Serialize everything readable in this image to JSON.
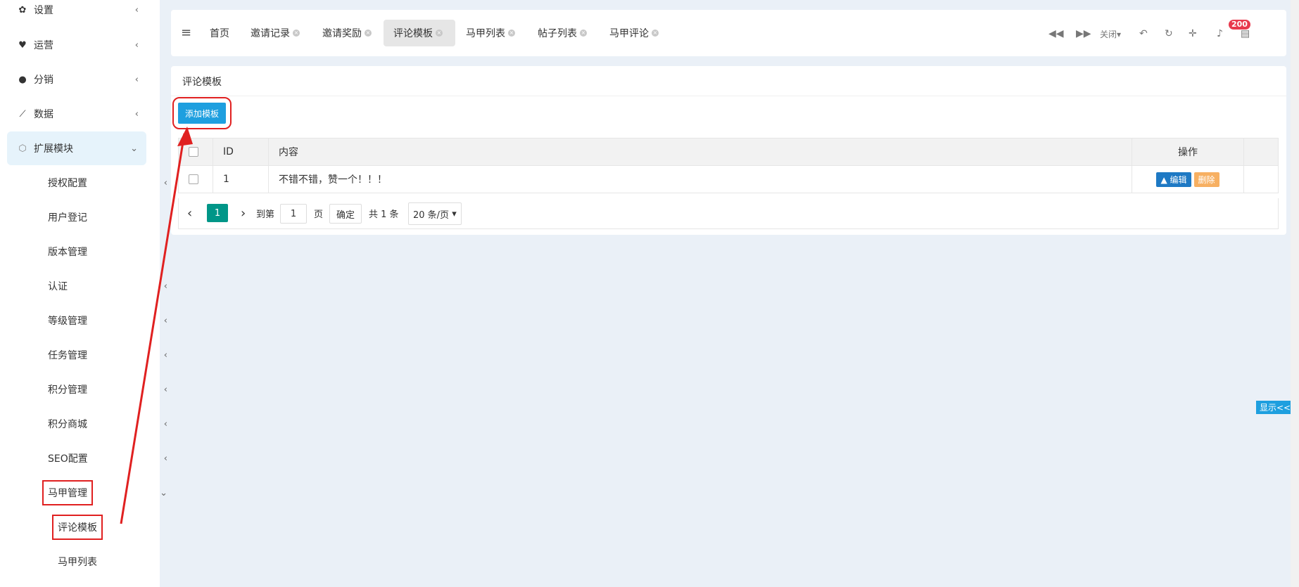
{
  "sidebar": {
    "items": [
      {
        "label": "设置",
        "icon": "gear-icon"
      },
      {
        "label": "运营",
        "icon": "heartbeat-icon"
      },
      {
        "label": "分销",
        "icon": "users-icon"
      },
      {
        "label": "数据",
        "icon": "line-chart-icon"
      },
      {
        "label": "扩展模块",
        "icon": "cube-icon"
      }
    ],
    "sub_items": [
      "授权配置",
      "用户登记",
      "版本管理",
      "认证",
      "等级管理",
      "任务管理",
      "积分管理",
      "积分商城",
      "SEO配置",
      "马甲管理"
    ],
    "sub_sub_items": [
      "评论模板",
      "马甲列表"
    ]
  },
  "tabs": [
    "首页",
    "邀请记录",
    "邀请奖励",
    "评论模板",
    "马甲列表",
    "帖子列表",
    "马甲评论"
  ],
  "toolbar": {
    "close_label": "关闭",
    "badge": "200"
  },
  "panel": {
    "title": "评论模板",
    "add_button": "添加模板"
  },
  "table": {
    "headers": {
      "id": "ID",
      "content": "内容",
      "actions": "操作"
    },
    "rows": [
      {
        "id": "1",
        "content": "不错不错，赞一个！！！"
      }
    ],
    "edit_label": "编辑",
    "delete_label": "删除"
  },
  "pager": {
    "current": "1",
    "goto_label": "到第",
    "goto_value": "1",
    "page_label": "页",
    "confirm": "确定",
    "total": "共 1 条",
    "page_size": "20 条/页"
  },
  "show_button": "显示<<"
}
